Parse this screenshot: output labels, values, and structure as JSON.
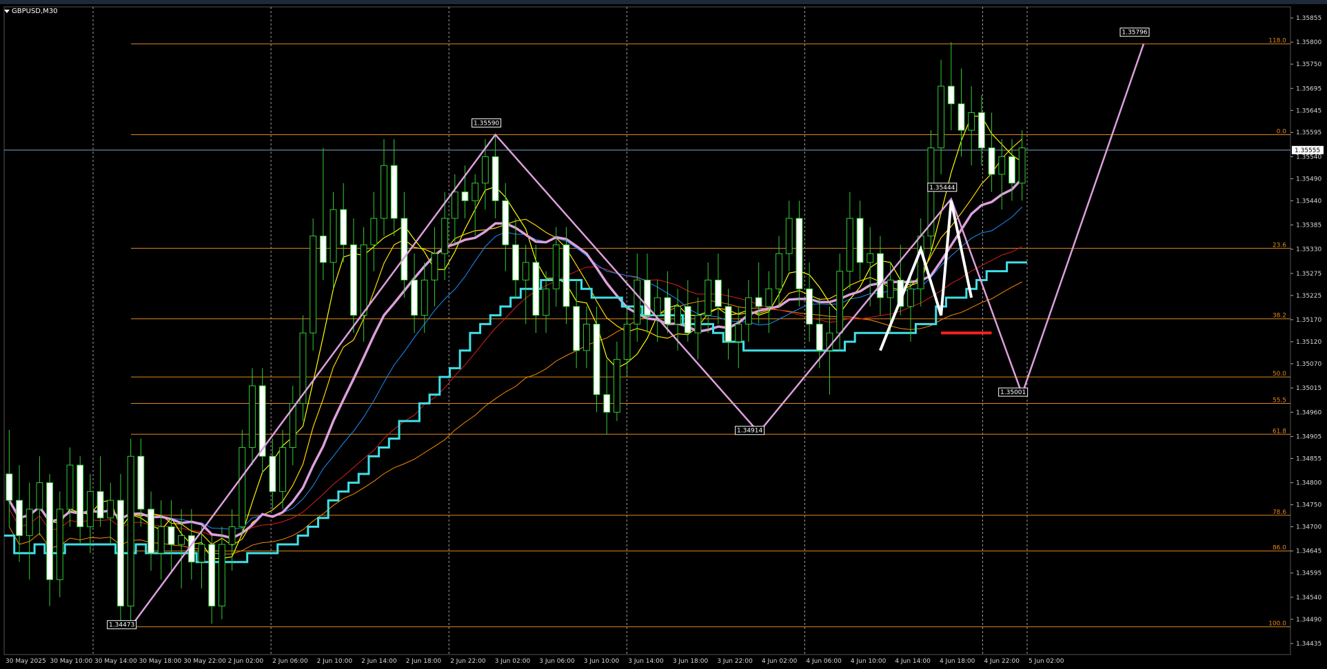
{
  "window": {
    "symbol_title": "GBPUSD,M30"
  },
  "colors": {
    "background": "#000000",
    "grid": "#c8c8c8",
    "bull_candle": "#32cd32",
    "bear_candle": "#ffffff",
    "fibo": "#e08a1e",
    "zigzag": "#dda0dd",
    "ma_fast": "#ffff00",
    "ma_mid": "#ffd700",
    "ma_slow_cyan": "#40e0e8",
    "ma_blue": "#1e90ff",
    "ma_red": "#dc1e1e",
    "ma_orange": "#ff8c00",
    "step_yellow": "#d4c200",
    "price_line": "#7fa7c8",
    "white_wave": "#ffffff",
    "red_mark": "#ff2020"
  },
  "chart_data": {
    "type": "candlestick",
    "symbol": "GBPUSD",
    "timeframe": "M30",
    "ylim": [
      1.3441,
      1.3588
    ],
    "x_tick_labels": [
      "30 May 2025",
      "30 May 10:00",
      "30 May 14:00",
      "30 May 18:00",
      "30 May 22:00",
      "2 Jun 02:00",
      "2 Jun 06:00",
      "2 Jun 10:00",
      "2 Jun 14:00",
      "2 Jun 18:00",
      "2 Jun 22:00",
      "3 Jun 02:00",
      "3 Jun 06:00",
      "3 Jun 10:00",
      "3 Jun 14:00",
      "3 Jun 18:00",
      "3 Jun 22:00",
      "4 Jun 02:00",
      "4 Jun 06:00",
      "4 Jun 10:00",
      "4 Jun 14:00",
      "4 Jun 18:00",
      "4 Jun 22:00",
      "5 Jun 02:00"
    ],
    "y_tick_labels": [
      "1.35855",
      "1.35800",
      "1.35750",
      "1.35695",
      "1.35645",
      "1.35595",
      "1.35540",
      "1.35490",
      "1.35440",
      "1.35385",
      "1.35330",
      "1.35275",
      "1.35225",
      "1.35170",
      "1.35120",
      "1.35070",
      "1.35015",
      "1.34960",
      "1.34905",
      "1.34855",
      "1.34800",
      "1.34750",
      "1.34700",
      "1.34645",
      "1.34595",
      "1.34540",
      "1.34490",
      "1.34435"
    ],
    "current_price": "1.35555",
    "fibo_levels": [
      {
        "label": "118.0",
        "price": 1.35796
      },
      {
        "label": "0.0",
        "price": 1.3559
      },
      {
        "label": "23.6",
        "price": 1.35332
      },
      {
        "label": "38.2",
        "price": 1.35172
      },
      {
        "label": "50.0",
        "price": 1.3504
      },
      {
        "label": "55.5",
        "price": 1.3498
      },
      {
        "label": "61.8",
        "price": 1.3491
      },
      {
        "label": "78.6",
        "price": 1.34726
      },
      {
        "label": "86.0",
        "price": 1.34645
      },
      {
        "label": "100.0",
        "price": 1.34473
      }
    ],
    "swing_labels": [
      {
        "text": "1.34473",
        "price": 1.34473,
        "bar": 12
      },
      {
        "text": "1.35590",
        "price": 1.3559,
        "bar": 48
      },
      {
        "text": "1.34914",
        "price": 1.34914,
        "bar": 74
      },
      {
        "text": "1.35444",
        "price": 1.35444,
        "bar": 93
      },
      {
        "text": "1.35001",
        "price": 1.35001,
        "bar": 100
      },
      {
        "text": "1.35796",
        "price": 1.35796,
        "bar": 112
      }
    ],
    "ohlc": [
      [
        1.3482,
        1.3492,
        1.347,
        1.3476
      ],
      [
        1.3476,
        1.3484,
        1.3462,
        1.3468
      ],
      [
        1.3468,
        1.348,
        1.3458,
        1.3474
      ],
      [
        1.3474,
        1.3486,
        1.3468,
        1.348
      ],
      [
        1.348,
        1.3482,
        1.3452,
        1.3458
      ],
      [
        1.3458,
        1.3478,
        1.3454,
        1.3474
      ],
      [
        1.3474,
        1.3488,
        1.347,
        1.3484
      ],
      [
        1.3484,
        1.3486,
        1.3466,
        1.347
      ],
      [
        1.347,
        1.3482,
        1.3464,
        1.3478
      ],
      [
        1.3478,
        1.3486,
        1.347,
        1.3472
      ],
      [
        1.3472,
        1.348,
        1.3466,
        1.3476
      ],
      [
        1.3476,
        1.3482,
        1.3448,
        1.3452
      ],
      [
        1.3452,
        1.349,
        1.3447,
        1.3486
      ],
      [
        1.3486,
        1.349,
        1.347,
        1.3474
      ],
      [
        1.3474,
        1.3478,
        1.346,
        1.3464
      ],
      [
        1.3464,
        1.3476,
        1.3458,
        1.347
      ],
      [
        1.347,
        1.3476,
        1.346,
        1.3466
      ],
      [
        1.3466,
        1.3474,
        1.3456,
        1.3468
      ],
      [
        1.3468,
        1.3474,
        1.3458,
        1.3462
      ],
      [
        1.3462,
        1.347,
        1.3456,
        1.3466
      ],
      [
        1.3466,
        1.3468,
        1.3448,
        1.3452
      ],
      [
        1.3452,
        1.347,
        1.3449,
        1.3466
      ],
      [
        1.3466,
        1.3474,
        1.346,
        1.347
      ],
      [
        1.347,
        1.3492,
        1.3468,
        1.3488
      ],
      [
        1.3488,
        1.3506,
        1.3484,
        1.3502
      ],
      [
        1.3502,
        1.3506,
        1.3482,
        1.3486
      ],
      [
        1.3486,
        1.349,
        1.3474,
        1.3478
      ],
      [
        1.3478,
        1.3492,
        1.3474,
        1.3488
      ],
      [
        1.3488,
        1.3502,
        1.3484,
        1.3498
      ],
      [
        1.3498,
        1.3518,
        1.3494,
        1.3514
      ],
      [
        1.3514,
        1.354,
        1.351,
        1.3536
      ],
      [
        1.3536,
        1.3556,
        1.3526,
        1.353
      ],
      [
        1.353,
        1.3546,
        1.3524,
        1.3542
      ],
      [
        1.3542,
        1.3548,
        1.353,
        1.3534
      ],
      [
        1.3534,
        1.354,
        1.3514,
        1.3518
      ],
      [
        1.3518,
        1.3538,
        1.3512,
        1.3534
      ],
      [
        1.3534,
        1.3546,
        1.3528,
        1.354
      ],
      [
        1.354,
        1.3558,
        1.3536,
        1.3552
      ],
      [
        1.3552,
        1.3558,
        1.3536,
        1.354
      ],
      [
        1.354,
        1.3546,
        1.3522,
        1.3526
      ],
      [
        1.3526,
        1.3532,
        1.3514,
        1.3518
      ],
      [
        1.3518,
        1.353,
        1.3514,
        1.3526
      ],
      [
        1.3526,
        1.3538,
        1.352,
        1.3532
      ],
      [
        1.3532,
        1.3546,
        1.3526,
        1.354
      ],
      [
        1.354,
        1.355,
        1.3534,
        1.3546
      ],
      [
        1.3546,
        1.3552,
        1.354,
        1.3544
      ],
      [
        1.3544,
        1.355,
        1.3536,
        1.3548
      ],
      [
        1.3548,
        1.3558,
        1.3542,
        1.3554
      ],
      [
        1.3554,
        1.3559,
        1.354,
        1.3544
      ],
      [
        1.3544,
        1.3548,
        1.3528,
        1.3534
      ],
      [
        1.3534,
        1.354,
        1.3522,
        1.3526
      ],
      [
        1.3526,
        1.3534,
        1.3516,
        1.353
      ],
      [
        1.353,
        1.3534,
        1.3514,
        1.3518
      ],
      [
        1.3518,
        1.3528,
        1.3514,
        1.3524
      ],
      [
        1.3524,
        1.3538,
        1.352,
        1.3534
      ],
      [
        1.3534,
        1.3538,
        1.3516,
        1.352
      ],
      [
        1.352,
        1.3526,
        1.3506,
        1.351
      ],
      [
        1.351,
        1.352,
        1.3506,
        1.3516
      ],
      [
        1.3516,
        1.352,
        1.3496,
        1.35
      ],
      [
        1.35,
        1.3508,
        1.3491,
        1.3496
      ],
      [
        1.3496,
        1.3512,
        1.3494,
        1.3508
      ],
      [
        1.3508,
        1.352,
        1.3504,
        1.3516
      ],
      [
        1.3516,
        1.3532,
        1.3512,
        1.3526
      ],
      [
        1.3526,
        1.3532,
        1.3514,
        1.3518
      ],
      [
        1.3518,
        1.3526,
        1.3512,
        1.3522
      ],
      [
        1.3522,
        1.3528,
        1.3514,
        1.3516
      ],
      [
        1.3516,
        1.3524,
        1.351,
        1.352
      ],
      [
        1.352,
        1.3526,
        1.3512,
        1.3514
      ],
      [
        1.3514,
        1.3522,
        1.3508,
        1.3518
      ],
      [
        1.3518,
        1.353,
        1.3514,
        1.3526
      ],
      [
        1.3526,
        1.3532,
        1.3516,
        1.352
      ],
      [
        1.352,
        1.3524,
        1.3508,
        1.3512
      ],
      [
        1.3512,
        1.352,
        1.3506,
        1.3516
      ],
      [
        1.3516,
        1.3526,
        1.3512,
        1.3522
      ],
      [
        1.3522,
        1.353,
        1.3516,
        1.352
      ],
      [
        1.352,
        1.3528,
        1.3514,
        1.3524
      ],
      [
        1.3524,
        1.3536,
        1.352,
        1.3532
      ],
      [
        1.3532,
        1.3544,
        1.3528,
        1.354
      ],
      [
        1.354,
        1.3544,
        1.352,
        1.3524
      ],
      [
        1.3524,
        1.353,
        1.3512,
        1.3516
      ],
      [
        1.3516,
        1.3522,
        1.3506,
        1.351
      ],
      [
        1.351,
        1.352,
        1.35,
        1.3514
      ],
      [
        1.3514,
        1.3532,
        1.351,
        1.3528
      ],
      [
        1.3528,
        1.3546,
        1.3524,
        1.354
      ],
      [
        1.354,
        1.3544,
        1.3526,
        1.353
      ],
      [
        1.353,
        1.3538,
        1.352,
        1.3532
      ],
      [
        1.3532,
        1.3536,
        1.3518,
        1.3522
      ],
      [
        1.3522,
        1.353,
        1.3514,
        1.3526
      ],
      [
        1.3526,
        1.3534,
        1.3518,
        1.352
      ],
      [
        1.352,
        1.3528,
        1.3512,
        1.3524
      ],
      [
        1.3524,
        1.354,
        1.352,
        1.3536
      ],
      [
        1.3536,
        1.356,
        1.3532,
        1.3556
      ],
      [
        1.3556,
        1.3576,
        1.355,
        1.357
      ],
      [
        1.357,
        1.358,
        1.356,
        1.3566
      ],
      [
        1.3566,
        1.3574,
        1.3554,
        1.356
      ],
      [
        1.356,
        1.357,
        1.3552,
        1.3564
      ],
      [
        1.3564,
        1.3568,
        1.3552,
        1.3556
      ],
      [
        1.3556,
        1.3564,
        1.3546,
        1.355
      ],
      [
        1.355,
        1.3558,
        1.3542,
        1.3554
      ],
      [
        1.3554,
        1.3558,
        1.3544,
        1.3548
      ],
      [
        1.3548,
        1.356,
        1.3544,
        1.3556
      ]
    ]
  },
  "axis": {
    "y_labels": [
      "1.35855",
      "1.35800",
      "1.35750",
      "1.35695",
      "1.35645",
      "1.35595",
      "1.35540",
      "1.35490",
      "1.35440",
      "1.35385",
      "1.35330",
      "1.35275",
      "1.35225",
      "1.35170",
      "1.35120",
      "1.35070",
      "1.35015",
      "1.34960",
      "1.34905",
      "1.34855",
      "1.34800",
      "1.34750",
      "1.34700",
      "1.34645",
      "1.34595",
      "1.34540",
      "1.34490",
      "1.34435"
    ],
    "x_labels": [
      "30 May 2025",
      "30 May 10:00",
      "30 May 14:00",
      "30 May 18:00",
      "30 May 22:00",
      "2 Jun 02:00",
      "2 Jun 06:00",
      "2 Jun 10:00",
      "2 Jun 14:00",
      "2 Jun 18:00",
      "2 Jun 22:00",
      "3 Jun 02:00",
      "3 Jun 06:00",
      "3 Jun 10:00",
      "3 Jun 14:00",
      "3 Jun 18:00",
      "3 Jun 22:00",
      "4 Jun 02:00",
      "4 Jun 06:00",
      "4 Jun 10:00",
      "4 Jun 14:00",
      "4 Jun 18:00",
      "4 Jun 22:00",
      "5 Jun 02:00"
    ]
  }
}
